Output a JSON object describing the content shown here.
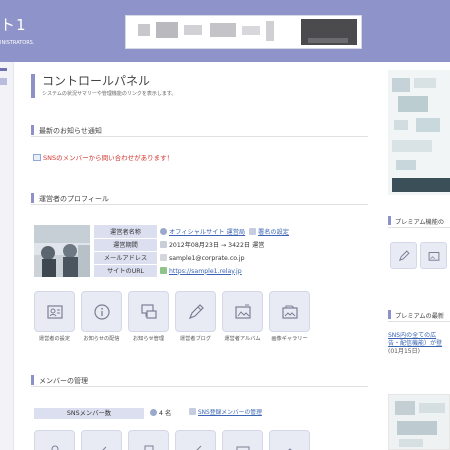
{
  "header": {
    "site_title": "ト1",
    "site_sub": "INISTRATORS."
  },
  "main": {
    "title": "コントロールパネル",
    "description": "システムの状況サマリーや管理機能のリンクを表示します。",
    "sections": {
      "notice_head": "最新のお知らせ通知",
      "profile_head": "運営者のプロフィール",
      "members_head": "メンバーの管理"
    },
    "notice_text": "SNSのメンバーから問い合わせがあります！",
    "profile": {
      "rows": [
        {
          "label": "運営者名称",
          "value": "オフィシャルサイト 運営局",
          "link": "署名の設定"
        },
        {
          "label": "運営期間",
          "value": "2012年08月23日 → 3422日 運営"
        },
        {
          "label": "メールアドレス",
          "value": "sample1@corprate.co.jp"
        },
        {
          "label": "サイトのURL",
          "value": "https://sample1.relay.jp"
        }
      ]
    },
    "admin_tiles": [
      {
        "label": "運営者の設定",
        "icon": "id-card-icon"
      },
      {
        "label": "お知らせの配信",
        "icon": "info-icon"
      },
      {
        "label": "お知らせ管理",
        "icon": "chat-icon"
      },
      {
        "label": "運営者ブログ",
        "icon": "pen-icon"
      },
      {
        "label": "運営者アルバム",
        "icon": "photo-edit-icon"
      },
      {
        "label": "画像ギャラリー",
        "icon": "gallery-icon"
      }
    ],
    "members": {
      "label": "SNSメンバー数",
      "count": "4 名",
      "link": "SNS登録メンバーの管理"
    }
  },
  "right": {
    "premium_head": "プレミアム機能の",
    "premium_latest_head": "プレミアムの最新",
    "news_line1": "SNS内の全ての広",
    "news_line2": "告・配信機能）が登",
    "news_date": "(01月15日)"
  },
  "colors": {
    "header_bg": "#8e93c9",
    "accent": "#8c91c8",
    "label_bg": "#dcdff0",
    "tile_bg": "#e9ebf4",
    "alert": "#d3382f",
    "link": "#3a63b3"
  }
}
